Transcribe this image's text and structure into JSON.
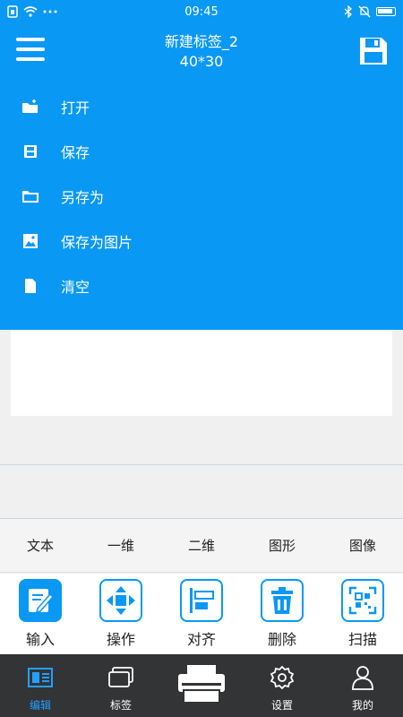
{
  "status_bar": {
    "time": "09:45",
    "icons": [
      "sim-icon",
      "wifi-icon",
      "more-dots-icon",
      "bluetooth-icon",
      "mute-icon",
      "battery-icon"
    ]
  },
  "header": {
    "title": "新建标签_2",
    "size": "40*30"
  },
  "dropdown_menu": [
    {
      "label": "打开",
      "icon": "open-folder-icon"
    },
    {
      "label": "保存",
      "icon": "save-icon"
    },
    {
      "label": "另存为",
      "icon": "save-as-icon"
    },
    {
      "label": "保存为图片",
      "icon": "image-icon"
    },
    {
      "label": "清空",
      "icon": "clear-document-icon"
    }
  ],
  "element_types": [
    "文本",
    "一维",
    "二维",
    "图形",
    "图像"
  ],
  "tools": [
    {
      "label": "输入",
      "icon": "edit-icon"
    },
    {
      "label": "操作",
      "icon": "move-arrows-icon"
    },
    {
      "label": "对齐",
      "icon": "align-icon"
    },
    {
      "label": "删除",
      "icon": "trash-icon"
    },
    {
      "label": "扫描",
      "icon": "scan-qr-icon"
    }
  ],
  "bottom_nav": [
    {
      "label": "编辑",
      "icon": "edit-label-icon",
      "active": true
    },
    {
      "label": "标签",
      "icon": "labels-icon",
      "active": false
    },
    {
      "label": "",
      "icon": "printer-icon",
      "active": false
    },
    {
      "label": "设置",
      "icon": "settings-gear-icon",
      "active": false
    },
    {
      "label": "我的",
      "icon": "user-icon",
      "active": false
    }
  ],
  "colors": {
    "primary": "#0a98f5",
    "nav_bg": "#333436",
    "nav_active": "#22a0ff"
  }
}
